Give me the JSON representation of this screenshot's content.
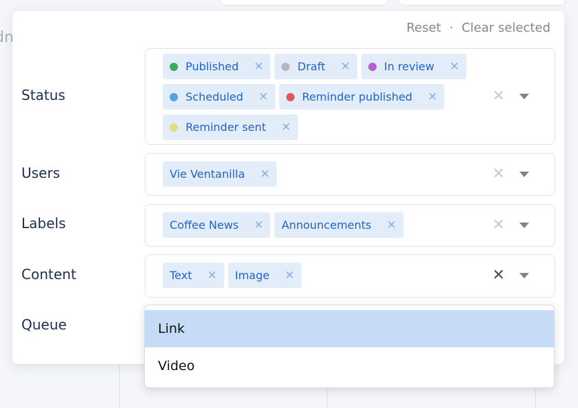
{
  "background": {
    "left_text": "dn"
  },
  "panel": {
    "reset_label": "Reset",
    "separator": "·",
    "clear_selected_label": "Clear selected"
  },
  "filters": {
    "status": {
      "label": "Status",
      "chips": [
        {
          "label": "Published",
          "dot_color": "#3ea95f"
        },
        {
          "label": "Draft",
          "dot_color": "#b4b8bf"
        },
        {
          "label": "In review",
          "dot_color": "#b35fd0"
        },
        {
          "label": "Scheduled",
          "dot_color": "#55a3dd"
        },
        {
          "label": "Reminder published",
          "dot_color": "#e0585d"
        },
        {
          "label": "Reminder sent",
          "dot_color": "#dfe07a"
        }
      ]
    },
    "users": {
      "label": "Users",
      "chips": [
        {
          "label": "Vie Ventanilla"
        }
      ]
    },
    "labels": {
      "label": "Labels",
      "chips": [
        {
          "label": "Coffee News"
        },
        {
          "label": "Announcements"
        }
      ]
    },
    "content": {
      "label": "Content",
      "chips": [
        {
          "label": "Text"
        },
        {
          "label": "Image"
        }
      ]
    },
    "queue": {
      "label": "Queue"
    }
  },
  "icons": {
    "chip_remove": "×",
    "clear": "✕"
  },
  "dropdown": {
    "options": [
      {
        "label": "Link",
        "highlighted": true
      },
      {
        "label": "Video",
        "highlighted": false
      }
    ]
  },
  "colors": {
    "chip_bg": "#e3edfa",
    "chip_text": "#1f63c4",
    "highlight": "#c6dbf6",
    "label_text": "#1d2f4f"
  }
}
